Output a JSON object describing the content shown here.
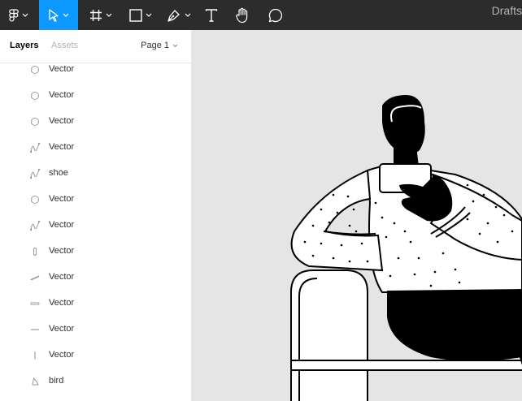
{
  "toolbar": {
    "file_title": "Drafts",
    "tools": [
      {
        "name": "figma-menu-icon"
      },
      {
        "name": "move-tool-icon",
        "active": true
      },
      {
        "name": "frame-tool-icon"
      },
      {
        "name": "shape-tool-icon"
      },
      {
        "name": "pen-tool-icon"
      },
      {
        "name": "text-tool-icon"
      },
      {
        "name": "hand-tool-icon"
      },
      {
        "name": "comment-tool-icon"
      }
    ],
    "accent_color": "#0d99ff"
  },
  "panel": {
    "tab_layers": "Layers",
    "tab_assets": "Assets",
    "page_selector": "Page 1",
    "layers": [
      {
        "label": "Vector",
        "icon": "ellipse-icon"
      },
      {
        "label": "Vector",
        "icon": "ellipse-icon"
      },
      {
        "label": "Vector",
        "icon": "ellipse-icon"
      },
      {
        "label": "Vector",
        "icon": "vector-path-icon"
      },
      {
        "label": "shoe",
        "icon": "vector-path-icon"
      },
      {
        "label": "Vector",
        "icon": "ellipse-icon"
      },
      {
        "label": "Vector",
        "icon": "vector-path-icon"
      },
      {
        "label": "Vector",
        "icon": "rounded-rect-icon"
      },
      {
        "label": "Vector",
        "icon": "diagonal-line-icon"
      },
      {
        "label": "Vector",
        "icon": "horizontal-bar-icon"
      },
      {
        "label": "Vector",
        "icon": "horizontal-line-icon"
      },
      {
        "label": "Vector",
        "icon": "vertical-line-icon"
      },
      {
        "label": "bird",
        "icon": "bird-shape-icon"
      }
    ]
  }
}
